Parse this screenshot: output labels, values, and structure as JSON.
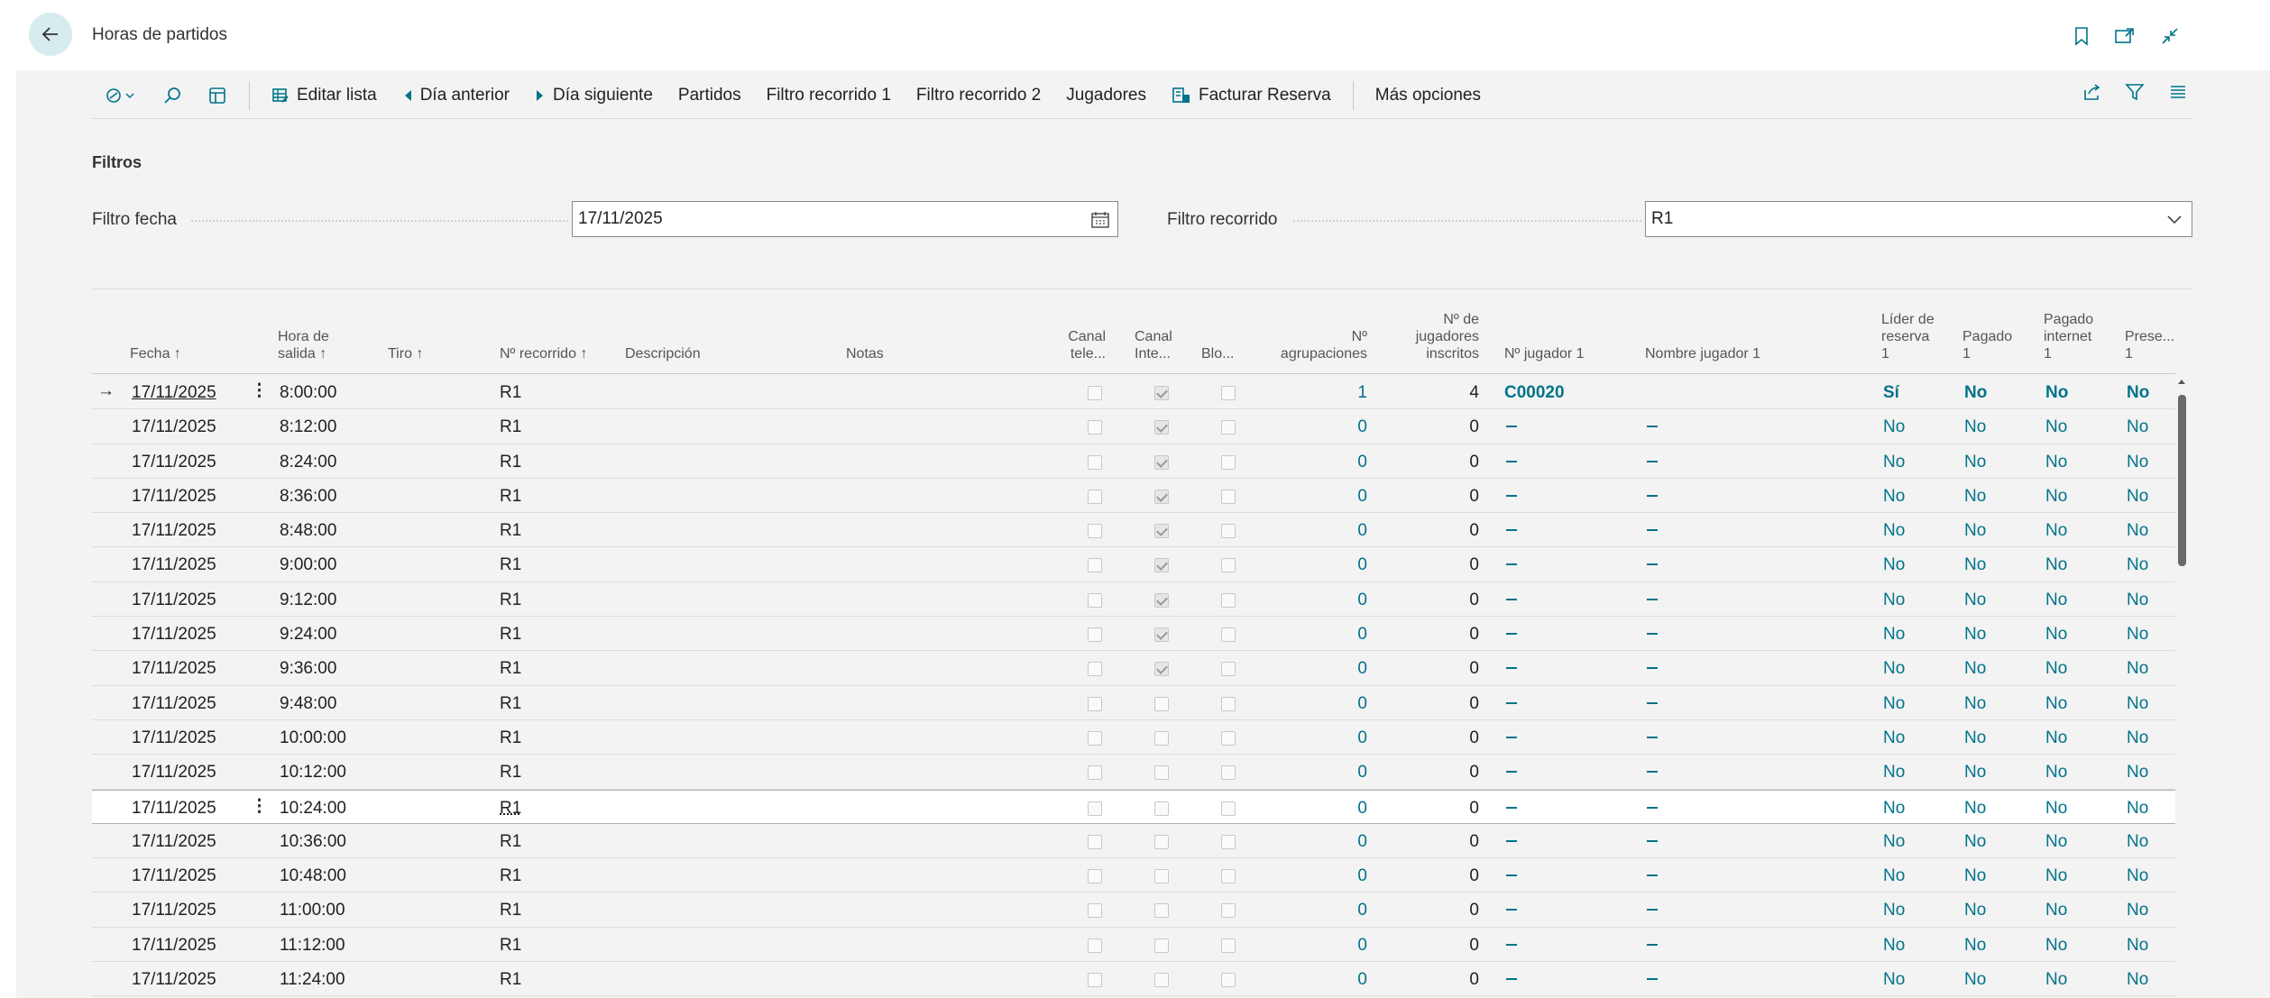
{
  "header": {
    "title": "Horas de partidos"
  },
  "toolbar": {
    "edit_list": "Editar lista",
    "prev_day": "Día anterior",
    "next_day": "Día siguiente",
    "matches": "Partidos",
    "filter_course_1": "Filtro recorrido 1",
    "filter_course_2": "Filtro recorrido 2",
    "players": "Jugadores",
    "invoice_booking": "Facturar Reserva",
    "more_options": "Más opciones"
  },
  "filters": {
    "title": "Filtros",
    "date_label": "Filtro fecha",
    "date_value": "17/11/2025",
    "course_label": "Filtro recorrido",
    "course_value": "R1"
  },
  "columns": {
    "fecha": "Fecha ↑",
    "hora_1": "Hora de",
    "hora_2": "salida ↑",
    "tiro": "Tiro ↑",
    "recorrido": "Nº recorrido ↑",
    "descripcion": "Descripción",
    "notas": "Notas",
    "canal_tele_1": "Canal",
    "canal_tele_2": "tele...",
    "canal_inte_1": "Canal",
    "canal_inte_2": "Inte...",
    "bloq": "Blo...",
    "agrup_1": "Nº",
    "agrup_2": "agrupaciones",
    "jug_1": "Nº de",
    "jug_2": "jugadores",
    "jug_3": "inscritos",
    "njug": "Nº jugador 1",
    "nombre": "Nombre jugador 1",
    "lider_1": "Líder de",
    "lider_2": "reserva",
    "lider_3": "1",
    "pagado_1": "Pagado",
    "pagado_2": "1",
    "pinternet_1": "Pagado",
    "pinternet_2": "internet",
    "pinternet_3": "1",
    "prese_1": "Prese...",
    "prese_2": "1"
  },
  "rows": [
    {
      "fecha": "17/11/2025",
      "hora": "8:00:00",
      "recorrido": "R1",
      "canal_inte": true,
      "agrup": "1",
      "inscritos": "4",
      "jugador": "C00020",
      "lider": "Sí",
      "pagado": "No",
      "pinternet": "No",
      "prese": "No"
    },
    {
      "fecha": "17/11/2025",
      "hora": "8:12:00",
      "recorrido": "R1",
      "canal_inte": true,
      "agrup": "0",
      "inscritos": "0",
      "jugador": "",
      "lider": "No",
      "pagado": "No",
      "pinternet": "No",
      "prese": "No"
    },
    {
      "fecha": "17/11/2025",
      "hora": "8:24:00",
      "recorrido": "R1",
      "canal_inte": true,
      "agrup": "0",
      "inscritos": "0",
      "jugador": "",
      "lider": "No",
      "pagado": "No",
      "pinternet": "No",
      "prese": "No"
    },
    {
      "fecha": "17/11/2025",
      "hora": "8:36:00",
      "recorrido": "R1",
      "canal_inte": true,
      "agrup": "0",
      "inscritos": "0",
      "jugador": "",
      "lider": "No",
      "pagado": "No",
      "pinternet": "No",
      "prese": "No"
    },
    {
      "fecha": "17/11/2025",
      "hora": "8:48:00",
      "recorrido": "R1",
      "canal_inte": true,
      "agrup": "0",
      "inscritos": "0",
      "jugador": "",
      "lider": "No",
      "pagado": "No",
      "pinternet": "No",
      "prese": "No"
    },
    {
      "fecha": "17/11/2025",
      "hora": "9:00:00",
      "recorrido": "R1",
      "canal_inte": true,
      "agrup": "0",
      "inscritos": "0",
      "jugador": "",
      "lider": "No",
      "pagado": "No",
      "pinternet": "No",
      "prese": "No"
    },
    {
      "fecha": "17/11/2025",
      "hora": "9:12:00",
      "recorrido": "R1",
      "canal_inte": true,
      "agrup": "0",
      "inscritos": "0",
      "jugador": "",
      "lider": "No",
      "pagado": "No",
      "pinternet": "No",
      "prese": "No"
    },
    {
      "fecha": "17/11/2025",
      "hora": "9:24:00",
      "recorrido": "R1",
      "canal_inte": true,
      "agrup": "0",
      "inscritos": "0",
      "jugador": "",
      "lider": "No",
      "pagado": "No",
      "pinternet": "No",
      "prese": "No"
    },
    {
      "fecha": "17/11/2025",
      "hora": "9:36:00",
      "recorrido": "R1",
      "canal_inte": true,
      "agrup": "0",
      "inscritos": "0",
      "jugador": "",
      "lider": "No",
      "pagado": "No",
      "pinternet": "No",
      "prese": "No"
    },
    {
      "fecha": "17/11/2025",
      "hora": "9:48:00",
      "recorrido": "R1",
      "canal_inte": false,
      "agrup": "0",
      "inscritos": "0",
      "jugador": "",
      "lider": "No",
      "pagado": "No",
      "pinternet": "No",
      "prese": "No"
    },
    {
      "fecha": "17/11/2025",
      "hora": "10:00:00",
      "recorrido": "R1",
      "canal_inte": false,
      "agrup": "0",
      "inscritos": "0",
      "jugador": "",
      "lider": "No",
      "pagado": "No",
      "pinternet": "No",
      "prese": "No"
    },
    {
      "fecha": "17/11/2025",
      "hora": "10:12:00",
      "recorrido": "R1",
      "canal_inte": false,
      "agrup": "0",
      "inscritos": "0",
      "jugador": "",
      "lider": "No",
      "pagado": "No",
      "pinternet": "No",
      "prese": "No"
    },
    {
      "fecha": "17/11/2025",
      "hora": "10:24:00",
      "recorrido": "R1",
      "canal_inte": false,
      "agrup": "0",
      "inscritos": "0",
      "jugador": "",
      "lider": "No",
      "pagado": "No",
      "pinternet": "No",
      "prese": "No"
    },
    {
      "fecha": "17/11/2025",
      "hora": "10:36:00",
      "recorrido": "R1",
      "canal_inte": false,
      "agrup": "0",
      "inscritos": "0",
      "jugador": "",
      "lider": "No",
      "pagado": "No",
      "pinternet": "No",
      "prese": "No"
    },
    {
      "fecha": "17/11/2025",
      "hora": "10:48:00",
      "recorrido": "R1",
      "canal_inte": false,
      "agrup": "0",
      "inscritos": "0",
      "jugador": "",
      "lider": "No",
      "pagado": "No",
      "pinternet": "No",
      "prese": "No"
    },
    {
      "fecha": "17/11/2025",
      "hora": "11:00:00",
      "recorrido": "R1",
      "canal_inte": false,
      "agrup": "0",
      "inscritos": "0",
      "jugador": "",
      "lider": "No",
      "pagado": "No",
      "pinternet": "No",
      "prese": "No"
    },
    {
      "fecha": "17/11/2025",
      "hora": "11:12:00",
      "recorrido": "R1",
      "canal_inte": false,
      "agrup": "0",
      "inscritos": "0",
      "jugador": "",
      "lider": "No",
      "pagado": "No",
      "pinternet": "No",
      "prese": "No"
    },
    {
      "fecha": "17/11/2025",
      "hora": "11:24:00",
      "recorrido": "R1",
      "canal_inte": false,
      "agrup": "0",
      "inscritos": "0",
      "jugador": "",
      "lider": "No",
      "pagado": "No",
      "pinternet": "No",
      "prese": "No"
    }
  ],
  "colors": {
    "accent": "#00738a",
    "panel_bg": "#f3f3f3",
    "back_button_bg": "#d7ecef"
  }
}
